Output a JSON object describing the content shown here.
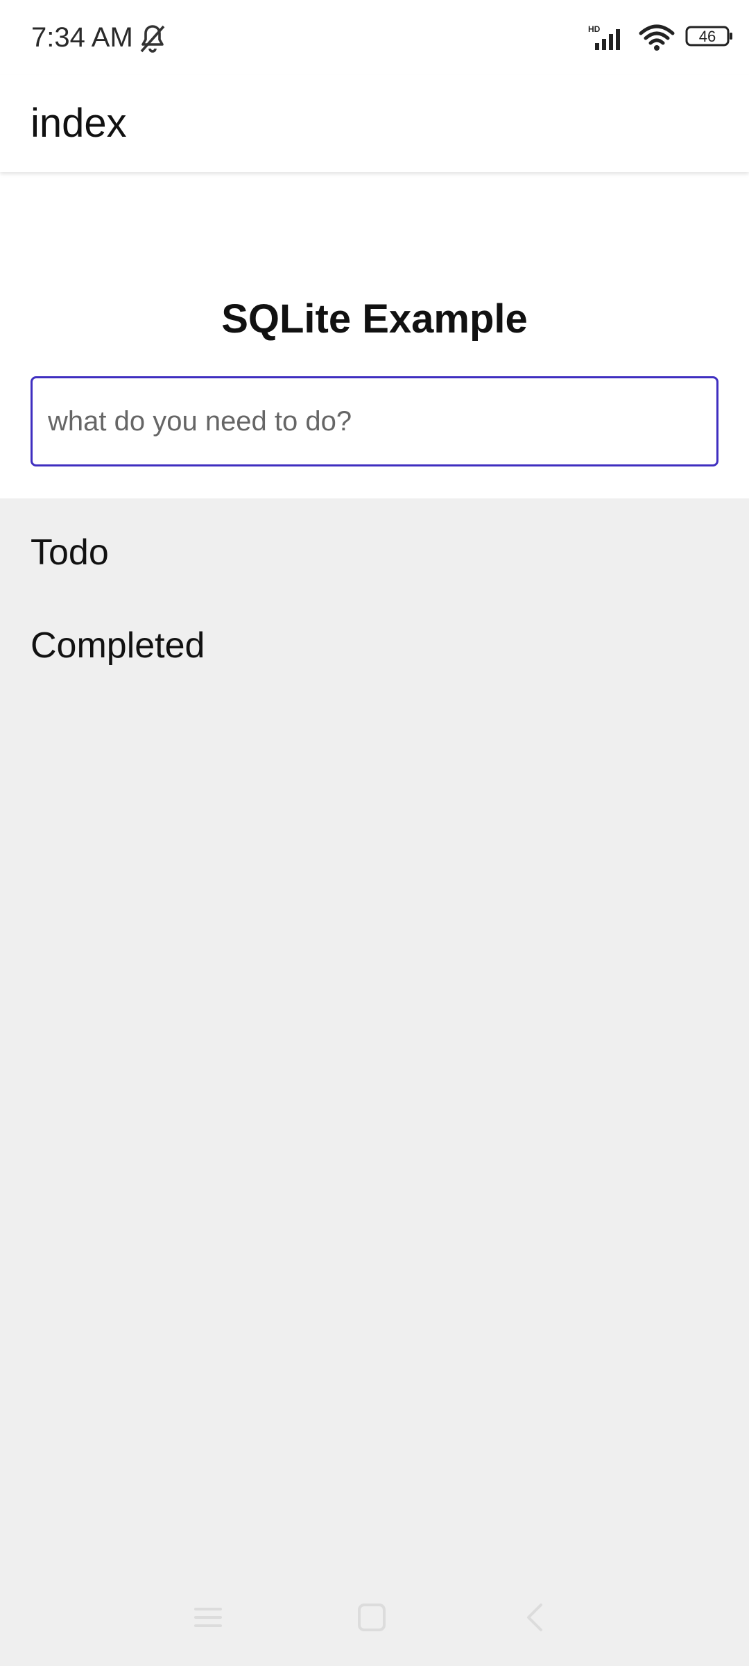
{
  "status_bar": {
    "time": "7:34 AM",
    "network_label": "HD",
    "battery_level": "46",
    "icons": [
      "bell-off-icon",
      "signal-icon",
      "wifi-icon",
      "battery-icon"
    ]
  },
  "app_bar": {
    "title": "index"
  },
  "main": {
    "title": "SQLite Example",
    "input": {
      "value": "",
      "placeholder": "what do you need to do?"
    },
    "sections": {
      "todo_label": "Todo",
      "completed_label": "Completed"
    }
  },
  "nav_bar": {
    "icons": [
      "menu-icon",
      "home-icon",
      "back-icon"
    ]
  },
  "colors": {
    "accent": "#3f2fc0",
    "background": "#efefef",
    "surface": "#ffffff"
  }
}
